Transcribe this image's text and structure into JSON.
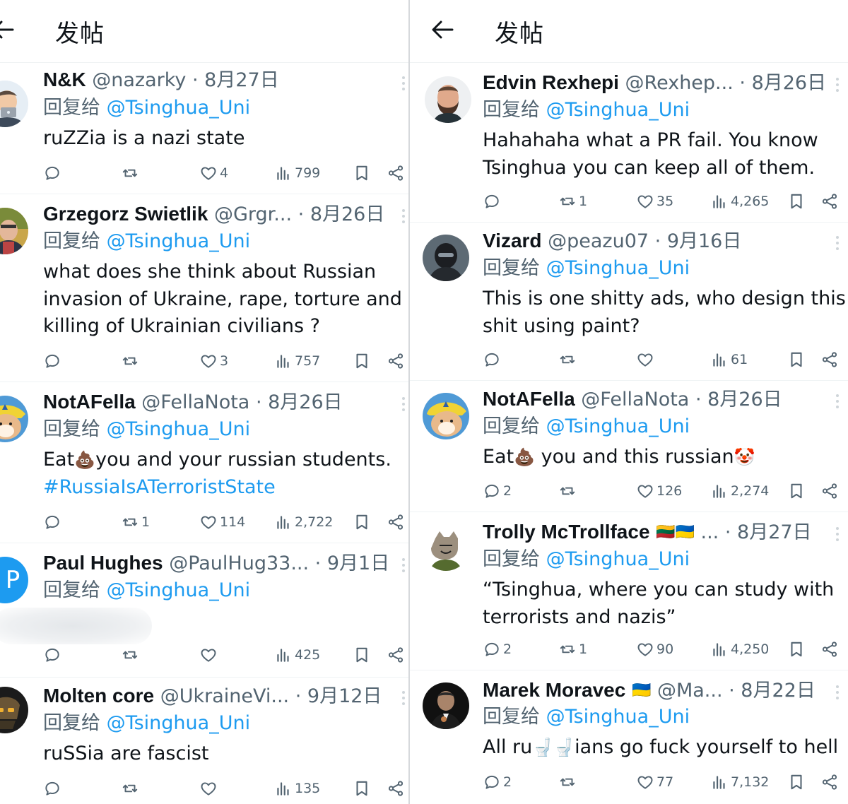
{
  "left": {
    "title": "发帖",
    "posts": [
      {
        "name": "N&K",
        "handle": "@nazarky",
        "date": "· 8月27日",
        "reply_label": "回复给",
        "reply_to": "@Tsinghua_Uni",
        "text": "ruZZia is a nazi state",
        "hashtag": "",
        "stats": {
          "reply": "",
          "retweet": "",
          "like": "4",
          "views": "799"
        },
        "avatar": "apple-memoji-avatar"
      },
      {
        "name": "Grzegorz Swietlik",
        "handle": "@Grgr...",
        "date": "· 8月26日",
        "reply_label": "回复给",
        "reply_to": "@Tsinghua_Uni",
        "text": "what does she think about Russian\ninvasion of Ukraine, rape, torture and\nkilling of Ukrainian civilians ?",
        "hashtag": "",
        "stats": {
          "reply": "",
          "retweet": "",
          "like": "3",
          "views": "757"
        },
        "avatar": "man-photo-avatar"
      },
      {
        "name": "NotAFella",
        "handle": "@FellaNota",
        "date": "· 8月26日",
        "reply_label": "回复给",
        "reply_to": "@Tsinghua_Uni",
        "text_before": "Eat",
        "text_after": "you and your russian students.",
        "hashtag": "#RussiaIsATerroristState",
        "stats": {
          "reply": "",
          "retweet": "1",
          "like": "114",
          "views": "2,722"
        },
        "avatar": "shiba-yellow-hat-avatar"
      },
      {
        "name": "Paul Hughes",
        "handle": "@PaulHug33...",
        "date": "· 9月1日",
        "reply_label": "回复给",
        "reply_to": "@Tsinghua_Uni",
        "text": "",
        "hashtag": "",
        "stats": {
          "reply": "",
          "retweet": "",
          "like": "",
          "views": "425"
        },
        "avatar_letter": "P"
      },
      {
        "name": "Molten core",
        "handle": "@UkraineVi...",
        "date": "· 9月12日",
        "reply_label": "回复给",
        "reply_to": "@Tsinghua_Uni",
        "text": "ruSSia are fascist",
        "hashtag": "",
        "stats": {
          "reply": "",
          "retweet": "",
          "like": "",
          "views": "135"
        },
        "avatar": "armored-helmet-avatar"
      }
    ]
  },
  "right": {
    "title": "发帖",
    "posts": [
      {
        "name": "Edvin Rexhepi",
        "handle": "@Rexhep...",
        "date": "· 8月26日",
        "reply_label": "回复给",
        "reply_to": "@Tsinghua_Uni",
        "text": "Hahahaha what a PR fail. You know\nTsinghua you can keep all of them.",
        "stats": {
          "reply": "",
          "retweet": "1",
          "like": "35",
          "views": "4,265"
        },
        "avatar": "bearded-man-avatar"
      },
      {
        "name": "Vizard",
        "handle": "@peazu07",
        "date": "· 9月16日",
        "reply_label": "回复给",
        "reply_to": "@Tsinghua_Uni",
        "text": "This is one shitty ads, who design this\nshit using paint?",
        "stats": {
          "reply": "",
          "retweet": "",
          "like": "",
          "views": "61"
        },
        "avatar": "masked-soldier-avatar"
      },
      {
        "name": "NotAFella",
        "handle": "@FellaNota",
        "date": "· 8月26日",
        "reply_label": "回复给",
        "reply_to": "@Tsinghua_Uni",
        "text_before": "Eat",
        "text_after": " you and this russian",
        "stats": {
          "reply": "2",
          "retweet": "",
          "like": "126",
          "views": "2,274"
        },
        "avatar": "shiba-yellow-hat-avatar"
      },
      {
        "name": "Trolly McTrollface",
        "flags": "🇱🇹🇺🇦",
        "handle": "...",
        "date": "· 8月27日",
        "reply_label": "回复给",
        "reply_to": "@Tsinghua_Uni",
        "text": "“Tsinghua, where you can study with\nterrorists and nazis”",
        "stats": {
          "reply": "2",
          "retweet": "1",
          "like": "90",
          "views": "4,250"
        },
        "avatar": "troll-cat-avatar"
      },
      {
        "name": "Marek Moravec",
        "flags": "🇺🇦",
        "handle": "@Ma...",
        "date": "· 8月22日",
        "reply_label": "回复给",
        "reply_to": "@Tsinghua_Uni",
        "text_before": "All ru",
        "text_after": "ians go fuck yourself to hell",
        "stats": {
          "reply": "2",
          "retweet": "",
          "like": "77",
          "views": "7,132"
        },
        "avatar": "godfather-avatar"
      }
    ]
  },
  "emoji": {
    "poop": "💩",
    "clown": "🤡",
    "toilet": "🚽"
  },
  "colors": {
    "link": "#1d9bf0",
    "muted": "#536471",
    "text": "#0f1419",
    "divider": "#eff3f4"
  }
}
